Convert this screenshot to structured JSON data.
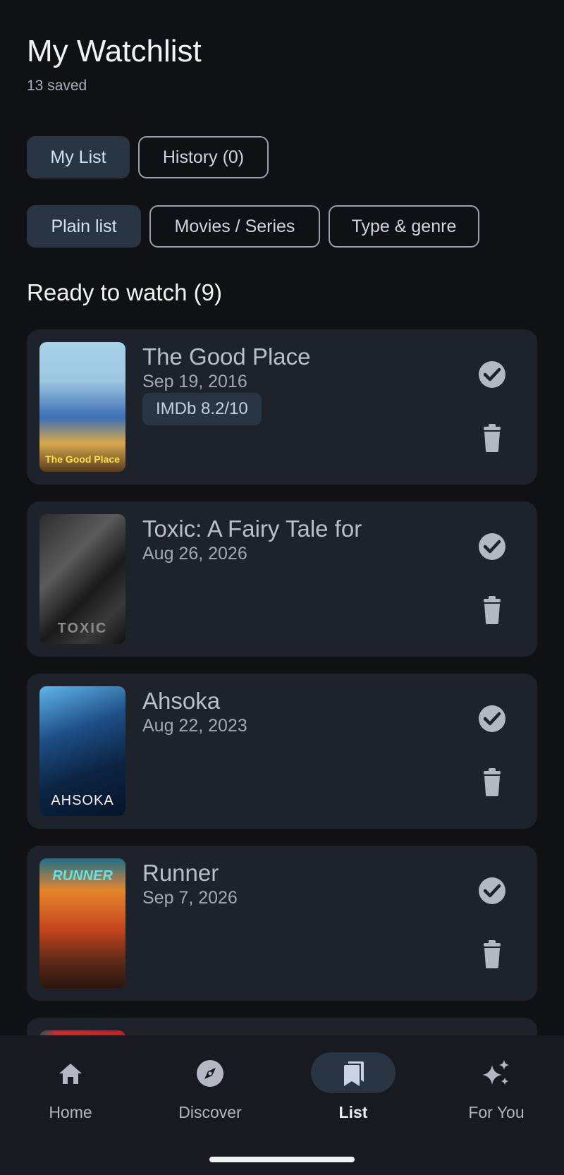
{
  "header": {
    "title": "My Watchlist",
    "subtitle": "13 saved"
  },
  "tabs": [
    {
      "label": "My List",
      "selected": true
    },
    {
      "label": "History (0)",
      "selected": false
    }
  ],
  "view_modes": [
    {
      "label": "Plain list",
      "selected": true
    },
    {
      "label": "Movies / Series",
      "selected": false
    },
    {
      "label": "Type & genre",
      "selected": false
    }
  ],
  "section": {
    "title": "Ready to watch (9)"
  },
  "items": [
    {
      "title": "The Good Place",
      "date": "Sep 19, 2016",
      "rating": "IMDb 8.2/10",
      "poster_text": "The Good Place"
    },
    {
      "title": "Toxic: A Fairy Tale for",
      "date": "Aug 26, 2026",
      "poster_text": "TOXIC"
    },
    {
      "title": "Ahsoka",
      "date": "Aug 22, 2023",
      "poster_text": "AHSOKA"
    },
    {
      "title": "Runner",
      "date": "Sep 7, 2026",
      "poster_text": "RUNNER"
    }
  ],
  "nav": [
    {
      "label": "Home",
      "icon": "home-icon",
      "active": false
    },
    {
      "label": "Discover",
      "icon": "compass-icon",
      "active": false
    },
    {
      "label": "List",
      "icon": "bookmarks-icon",
      "active": true
    },
    {
      "label": "For You",
      "icon": "sparkle-icon",
      "active": false
    }
  ],
  "colors": {
    "background": "#0f1115",
    "card": "#1e222a",
    "accent": "#2a3544"
  }
}
